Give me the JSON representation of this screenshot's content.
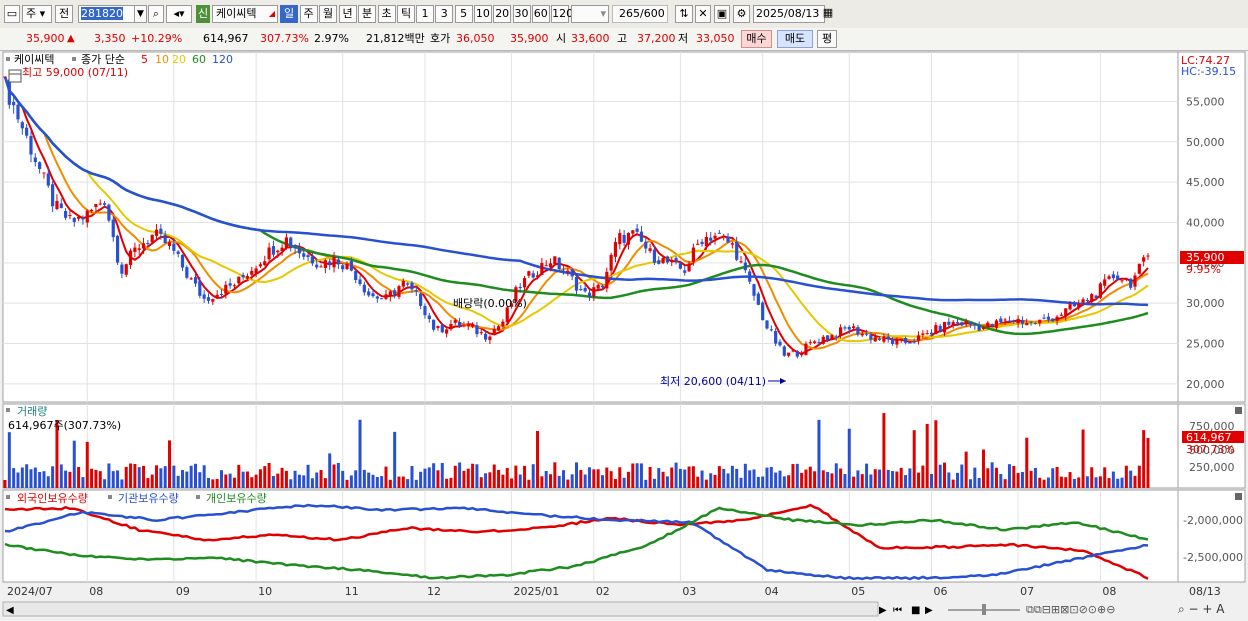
{
  "toolbar": {
    "type_selector": "주",
    "prev_button": "전",
    "code_input": "281820",
    "new_badge": "신",
    "stock_name": "케이씨텍",
    "period_tabs": [
      "일",
      "주",
      "월",
      "년",
      "분",
      "초",
      "틱"
    ],
    "interval_tabs": [
      "1",
      "3",
      "5",
      "10",
      "20",
      "30",
      "60",
      "120"
    ],
    "count_input": "265",
    "count_total": "/600",
    "date_input": "2025/08/13"
  },
  "quote": {
    "price": "35,900",
    "arrow": "▲",
    "change": "3,350",
    "change_pct": "+10.29%",
    "volume": "614,967",
    "volume_ratio": "307.73%",
    "turnover_pct": "2.97%",
    "amount": "21,812백만",
    "hoga_label": "호가",
    "ask": "36,050",
    "bid": "35,900",
    "open_label": "시",
    "open": "33,600",
    "high_label": "고",
    "high": "37,200",
    "low_label": "저",
    "low": "33,050",
    "buy_button": "매수",
    "sell_button": "매도",
    "eval_button": "평"
  },
  "price_panel": {
    "legend_name": "케이씨텍",
    "legend_series": "종가 단순",
    "ma_labels": [
      "5",
      "10",
      "20",
      "60",
      "120"
    ],
    "ma_colors": [
      "#e00000",
      "#f08c00",
      "#e6c800",
      "#1e8c1e",
      "#2850d2"
    ],
    "high_note": "최고 59,000 (07/11)",
    "lc": "LC:74.27",
    "hc": "HC:-39.15",
    "dividend_note": "배당락(0.00%)",
    "low_note": "최저 20,600 (04/11)",
    "last_price_label": "35,900",
    "last_pct_label": "9.95%",
    "yticks": [
      "55,000",
      "50,000",
      "45,000",
      "40,000",
      "35,000",
      "30,000",
      "25,000",
      "20,000"
    ]
  },
  "volume_panel": {
    "title": "거래량",
    "value_note": "614,967주(307.73%)",
    "yticks": [
      "750,000",
      "500,000",
      "250,000"
    ],
    "last_label": "614,967",
    "last_pct": "307.73%"
  },
  "holding_panel": {
    "series": [
      "외국인보유수량",
      "기관보유수량",
      "개인보유수량"
    ],
    "series_colors": [
      "#e00000",
      "#2850d2",
      "#1e8c1e"
    ],
    "yticks": [
      "-2,000,000",
      "-2,500,000"
    ]
  },
  "xaxis": {
    "labels": [
      "2024/07",
      "08",
      "09",
      "10",
      "11",
      "12",
      "2025/01",
      "02",
      "03",
      "04",
      "05",
      "06",
      "07",
      "08"
    ],
    "last": "08/13"
  },
  "chart_data": {
    "type": "candlestick",
    "period": "daily",
    "ylim": [
      18000,
      61000
    ],
    "months": [
      "2024/07",
      "08",
      "09",
      "10",
      "11",
      "12",
      "2025/01",
      "02",
      "03",
      "04",
      "05",
      "06",
      "07",
      "08"
    ],
    "close_anchors": [
      {
        "month": "2024/07",
        "close": [
          57000,
          52000,
          47000,
          42000,
          40000
        ]
      },
      {
        "month": "08",
        "close": [
          41000,
          43000,
          34000,
          37000,
          38500
        ]
      },
      {
        "month": "09",
        "close": [
          37000,
          33500,
          30500,
          31500,
          32500
        ]
      },
      {
        "month": "10",
        "close": [
          34500,
          36500,
          38000,
          36000,
          35000
        ]
      },
      {
        "month": "11",
        "close": [
          35500,
          34000,
          31000,
          30500,
          32500
        ]
      },
      {
        "month": "12",
        "close": [
          30500,
          26500,
          27500,
          27000,
          26000
        ]
      },
      {
        "month": "2025/01",
        "close": [
          27500,
          32000,
          34000,
          35500,
          33500
        ]
      },
      {
        "month": "02",
        "close": [
          31000,
          32000,
          38000,
          38500,
          36000
        ]
      },
      {
        "month": "03",
        "close": [
          35000,
          34000,
          38000,
          38500,
          37000
        ]
      },
      {
        "month": "04",
        "close": [
          32000,
          27000,
          23500,
          24000,
          25500
        ]
      },
      {
        "month": "05",
        "close": [
          26000,
          27000,
          26000,
          25500,
          25000
        ]
      },
      {
        "month": "06",
        "close": [
          25500,
          26500,
          27500,
          27500,
          27000
        ]
      },
      {
        "month": "07",
        "close": [
          27500,
          28000,
          27500,
          28000,
          29000
        ]
      },
      {
        "month": "08",
        "close": [
          30000,
          31500,
          33500,
          32550,
          35900
        ]
      }
    ],
    "last_close": 35900,
    "highest": {
      "value": 59000,
      "date": "07/11"
    },
    "lowest": {
      "value": 20600,
      "date": "04/11"
    }
  }
}
